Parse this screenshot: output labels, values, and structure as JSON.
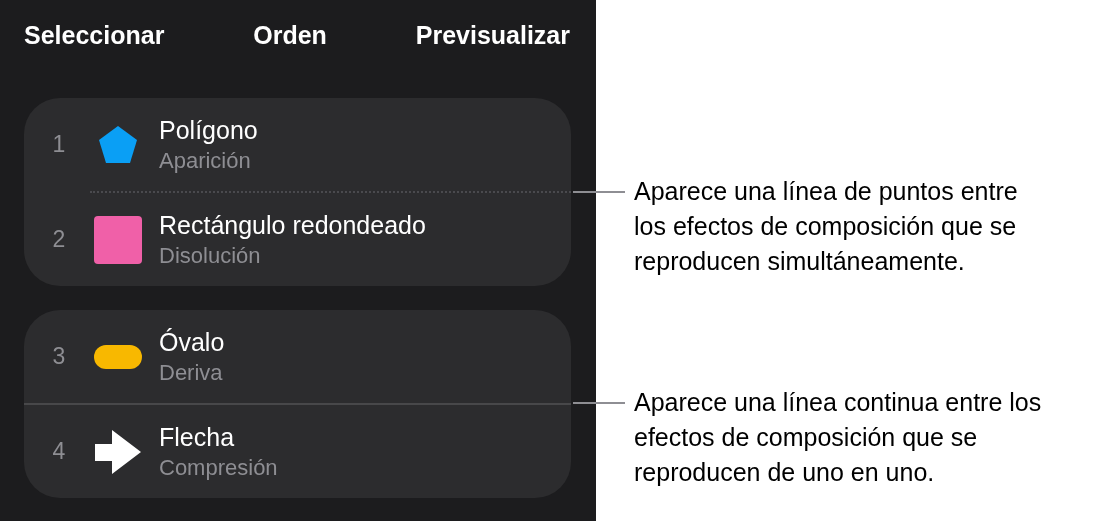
{
  "toolbar": {
    "buttons": [
      "Seleccionar",
      "Orden",
      "Previsualizar"
    ]
  },
  "groups": [
    {
      "dotted_separator": true,
      "items": [
        {
          "number": "1",
          "name": "Polígono",
          "effect": "Aparición",
          "kind": "pentagon"
        },
        {
          "number": "2",
          "name": "Rectángulo redondeado",
          "effect": "Disolución",
          "kind": "square"
        }
      ]
    },
    {
      "dotted_separator": false,
      "items": [
        {
          "number": "3",
          "name": "Óvalo",
          "effect": "Deriva",
          "kind": "oval"
        },
        {
          "number": "4",
          "name": "Flecha",
          "effect": "Compresión",
          "kind": "arrow"
        }
      ]
    }
  ],
  "callouts": [
    {
      "text": "Aparece una línea de puntos entre los efectos de composición que se reproducen simultáneamente."
    },
    {
      "text": "Aparece una línea continua entre los efectos de composición que se reproducen de uno en uno."
    }
  ]
}
